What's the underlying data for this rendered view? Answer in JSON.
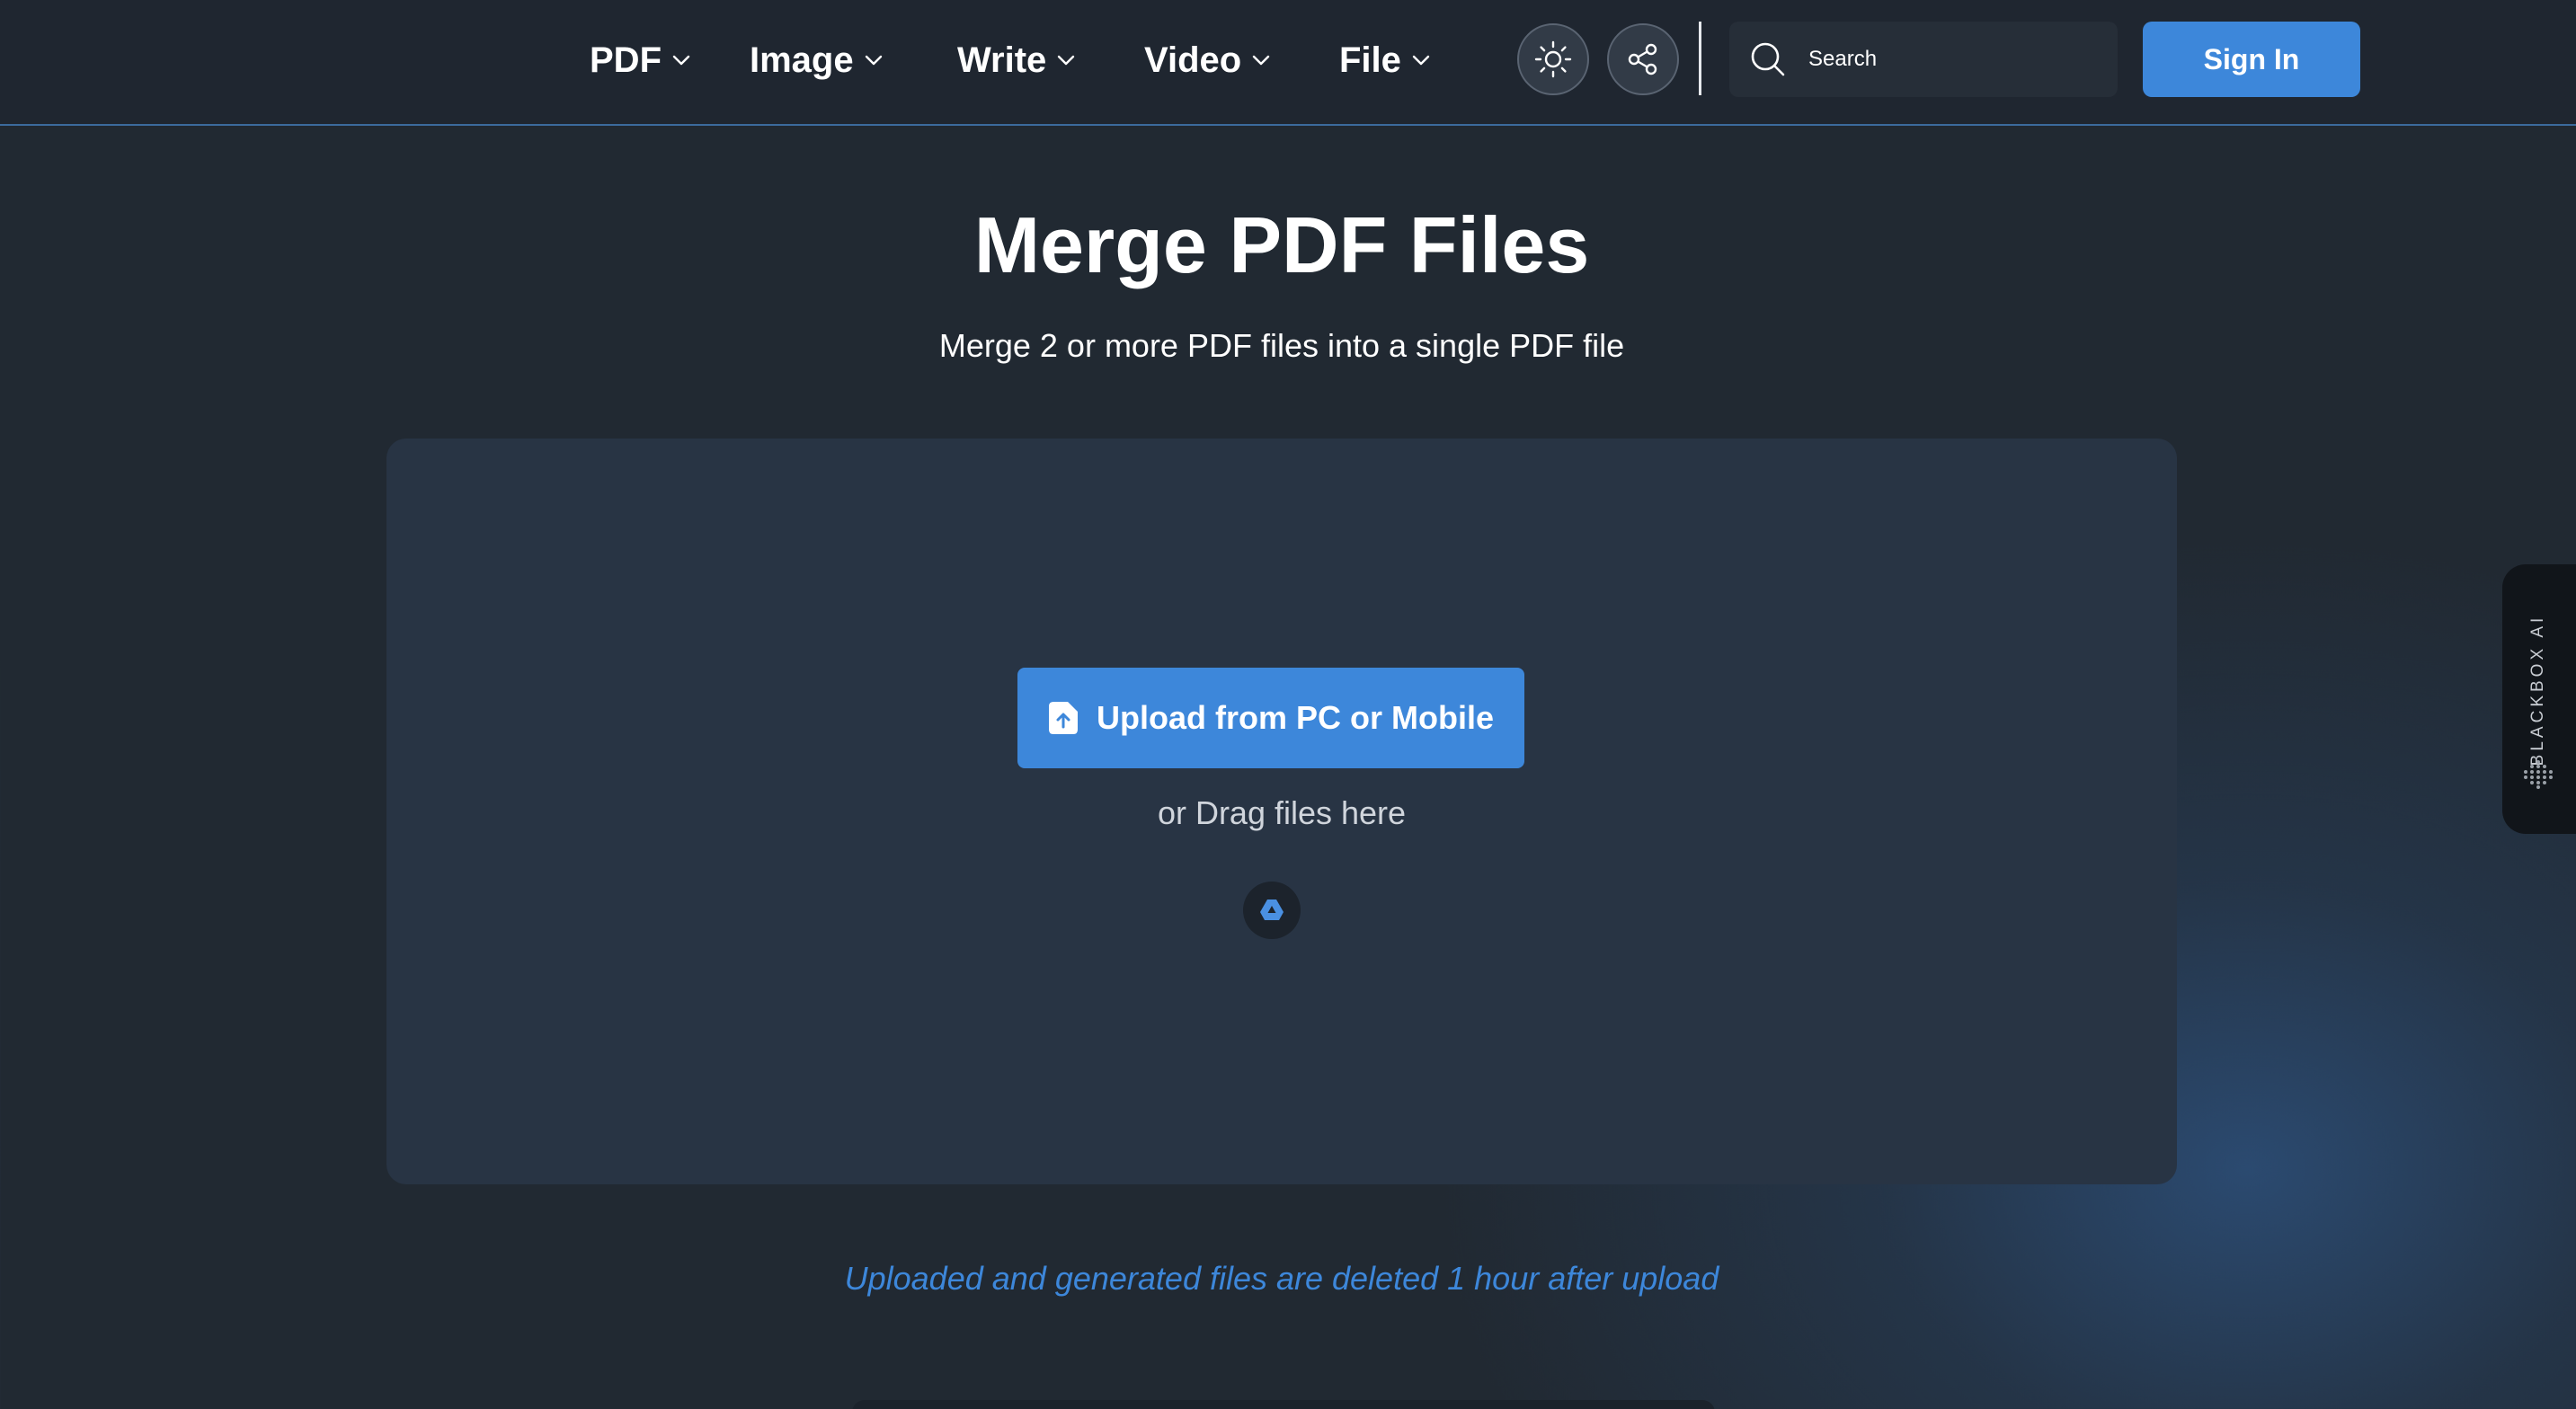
{
  "nav": {
    "items": [
      {
        "label": "PDF"
      },
      {
        "label": "Image"
      },
      {
        "label": "Write"
      },
      {
        "label": "Video"
      },
      {
        "label": "File"
      }
    ],
    "theme_toggle_icon": "sun-icon",
    "share_icon": "share-icon",
    "search": {
      "placeholder": "Search",
      "icon": "search-icon"
    },
    "sign_in_label": "Sign In"
  },
  "main": {
    "title": "Merge PDF Files",
    "subtitle": "Merge 2 or more PDF files into a single PDF file",
    "upload_label": "Upload from PC or Mobile",
    "upload_icon": "file-upload-icon",
    "drag_text": "or Drag files here",
    "drive_icon": "google-drive-icon",
    "notice": "Uploaded and generated files are deleted 1 hour after upload"
  },
  "side_tab": {
    "label": "BLACKBOX AI"
  },
  "colors": {
    "accent": "#3d87da",
    "background": "#212932",
    "header": "#1f2630",
    "dropzone": "#283444"
  }
}
